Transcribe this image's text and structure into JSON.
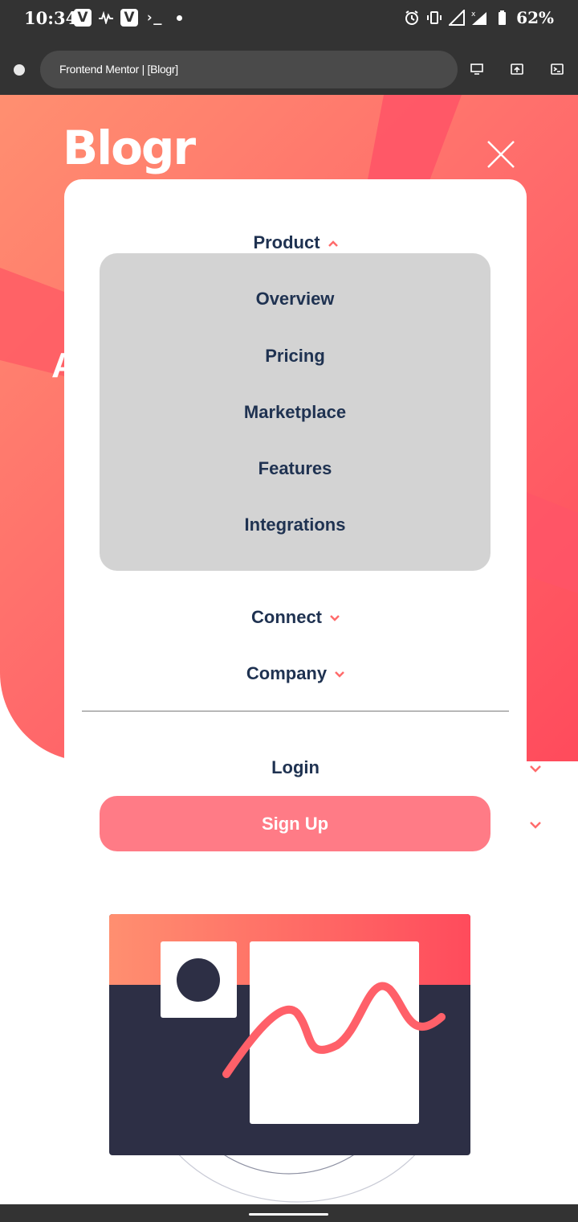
{
  "status_bar": {
    "time": "10:34",
    "left_icons": [
      "vivaldi-icon",
      "pulse-icon",
      "vivaldi-icon",
      "terminal-icon",
      "dot-icon"
    ],
    "vivaldi_letter": "V",
    "terminal_glyph": "›_",
    "right_icons": [
      "alarm-icon",
      "vibrate-icon",
      "signal-icon",
      "signal-x-icon",
      "battery-icon"
    ],
    "battery": "62%"
  },
  "browser": {
    "title": "Frontend Mentor | [Blogr]",
    "icons": [
      "desktop-icon",
      "share-icon",
      "terminal-icon"
    ]
  },
  "header": {
    "logo": "Blogr",
    "hero_partial_letter": "A"
  },
  "menu": {
    "product": "Product",
    "product_items": [
      "Overview",
      "Pricing",
      "Marketplace",
      "Features",
      "Integrations"
    ],
    "connect": "Connect",
    "company": "Company",
    "login": "Login",
    "signup": "Sign Up"
  },
  "colors": {
    "accent": "#ff6b6b",
    "button": "#ff7b86",
    "text_dark": "#1f3251",
    "submenu_bg": "#d3d3d3",
    "illustration_dark": "#2d2f45"
  }
}
